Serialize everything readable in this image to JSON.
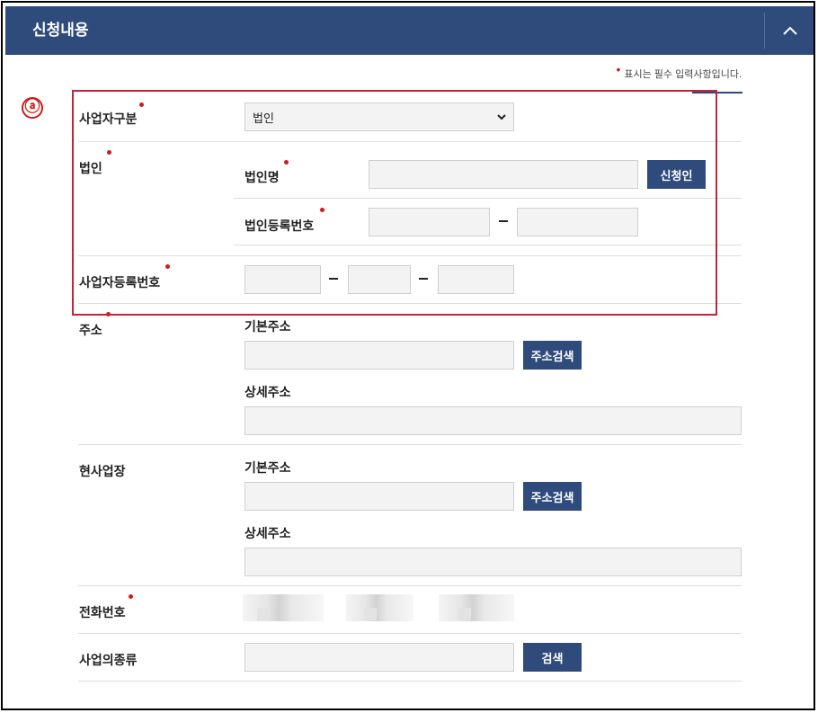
{
  "header": {
    "title": "신청내용",
    "toggle_icon": "chevron-up-icon"
  },
  "required_note": "표시는 필수 입력사항입니다.",
  "section_marker": "ⓐ",
  "business_type": {
    "label": "사업자구분",
    "selected": "법인"
  },
  "corporation": {
    "label": "법인",
    "name_label": "법인명",
    "name_value": "",
    "applicant_button": "신청인",
    "reg_no_label": "법인등록번호"
  },
  "business_reg_no": {
    "label": "사업자등록번호"
  },
  "address": {
    "label": "주소",
    "basic_label": "기본주소",
    "search_button": "주소검색",
    "detail_label": "상세주소"
  },
  "site": {
    "label": "현사업장",
    "basic_label": "기본주소",
    "search_button": "주소검색",
    "detail_label": "상세주소"
  },
  "phone": {
    "label": "전화번호"
  },
  "business_kind": {
    "label": "사업의종류",
    "search_button": "검색"
  },
  "colors": {
    "header_bg": "#2f4b7c",
    "required_dot": "#d01b1b",
    "highlight_box": "#c4243a"
  }
}
